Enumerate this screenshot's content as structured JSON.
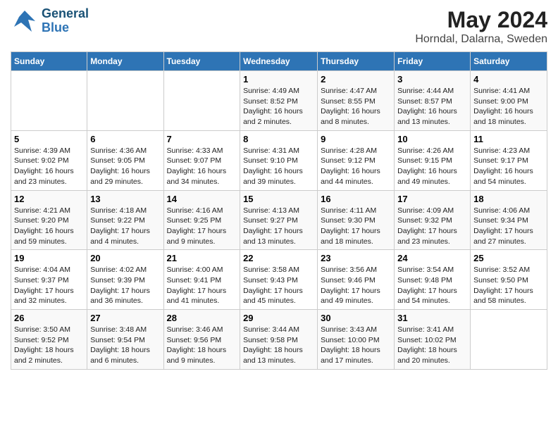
{
  "header": {
    "logo_line1": "General",
    "logo_line2": "Blue",
    "main_title": "May 2024",
    "subtitle": "Horndal, Dalarna, Sweden"
  },
  "calendar": {
    "days_of_week": [
      "Sunday",
      "Monday",
      "Tuesday",
      "Wednesday",
      "Thursday",
      "Friday",
      "Saturday"
    ],
    "weeks": [
      [
        {
          "day": "",
          "info": ""
        },
        {
          "day": "",
          "info": ""
        },
        {
          "day": "",
          "info": ""
        },
        {
          "day": "1",
          "info": "Sunrise: 4:49 AM\nSunset: 8:52 PM\nDaylight: 16 hours\nand 2 minutes."
        },
        {
          "day": "2",
          "info": "Sunrise: 4:47 AM\nSunset: 8:55 PM\nDaylight: 16 hours\nand 8 minutes."
        },
        {
          "day": "3",
          "info": "Sunrise: 4:44 AM\nSunset: 8:57 PM\nDaylight: 16 hours\nand 13 minutes."
        },
        {
          "day": "4",
          "info": "Sunrise: 4:41 AM\nSunset: 9:00 PM\nDaylight: 16 hours\nand 18 minutes."
        }
      ],
      [
        {
          "day": "5",
          "info": "Sunrise: 4:39 AM\nSunset: 9:02 PM\nDaylight: 16 hours\nand 23 minutes."
        },
        {
          "day": "6",
          "info": "Sunrise: 4:36 AM\nSunset: 9:05 PM\nDaylight: 16 hours\nand 29 minutes."
        },
        {
          "day": "7",
          "info": "Sunrise: 4:33 AM\nSunset: 9:07 PM\nDaylight: 16 hours\nand 34 minutes."
        },
        {
          "day": "8",
          "info": "Sunrise: 4:31 AM\nSunset: 9:10 PM\nDaylight: 16 hours\nand 39 minutes."
        },
        {
          "day": "9",
          "info": "Sunrise: 4:28 AM\nSunset: 9:12 PM\nDaylight: 16 hours\nand 44 minutes."
        },
        {
          "day": "10",
          "info": "Sunrise: 4:26 AM\nSunset: 9:15 PM\nDaylight: 16 hours\nand 49 minutes."
        },
        {
          "day": "11",
          "info": "Sunrise: 4:23 AM\nSunset: 9:17 PM\nDaylight: 16 hours\nand 54 minutes."
        }
      ],
      [
        {
          "day": "12",
          "info": "Sunrise: 4:21 AM\nSunset: 9:20 PM\nDaylight: 16 hours\nand 59 minutes."
        },
        {
          "day": "13",
          "info": "Sunrise: 4:18 AM\nSunset: 9:22 PM\nDaylight: 17 hours\nand 4 minutes."
        },
        {
          "day": "14",
          "info": "Sunrise: 4:16 AM\nSunset: 9:25 PM\nDaylight: 17 hours\nand 9 minutes."
        },
        {
          "day": "15",
          "info": "Sunrise: 4:13 AM\nSunset: 9:27 PM\nDaylight: 17 hours\nand 13 minutes."
        },
        {
          "day": "16",
          "info": "Sunrise: 4:11 AM\nSunset: 9:30 PM\nDaylight: 17 hours\nand 18 minutes."
        },
        {
          "day": "17",
          "info": "Sunrise: 4:09 AM\nSunset: 9:32 PM\nDaylight: 17 hours\nand 23 minutes."
        },
        {
          "day": "18",
          "info": "Sunrise: 4:06 AM\nSunset: 9:34 PM\nDaylight: 17 hours\nand 27 minutes."
        }
      ],
      [
        {
          "day": "19",
          "info": "Sunrise: 4:04 AM\nSunset: 9:37 PM\nDaylight: 17 hours\nand 32 minutes."
        },
        {
          "day": "20",
          "info": "Sunrise: 4:02 AM\nSunset: 9:39 PM\nDaylight: 17 hours\nand 36 minutes."
        },
        {
          "day": "21",
          "info": "Sunrise: 4:00 AM\nSunset: 9:41 PM\nDaylight: 17 hours\nand 41 minutes."
        },
        {
          "day": "22",
          "info": "Sunrise: 3:58 AM\nSunset: 9:43 PM\nDaylight: 17 hours\nand 45 minutes."
        },
        {
          "day": "23",
          "info": "Sunrise: 3:56 AM\nSunset: 9:46 PM\nDaylight: 17 hours\nand 49 minutes."
        },
        {
          "day": "24",
          "info": "Sunrise: 3:54 AM\nSunset: 9:48 PM\nDaylight: 17 hours\nand 54 minutes."
        },
        {
          "day": "25",
          "info": "Sunrise: 3:52 AM\nSunset: 9:50 PM\nDaylight: 17 hours\nand 58 minutes."
        }
      ],
      [
        {
          "day": "26",
          "info": "Sunrise: 3:50 AM\nSunset: 9:52 PM\nDaylight: 18 hours\nand 2 minutes."
        },
        {
          "day": "27",
          "info": "Sunrise: 3:48 AM\nSunset: 9:54 PM\nDaylight: 18 hours\nand 6 minutes."
        },
        {
          "day": "28",
          "info": "Sunrise: 3:46 AM\nSunset: 9:56 PM\nDaylight: 18 hours\nand 9 minutes."
        },
        {
          "day": "29",
          "info": "Sunrise: 3:44 AM\nSunset: 9:58 PM\nDaylight: 18 hours\nand 13 minutes."
        },
        {
          "day": "30",
          "info": "Sunrise: 3:43 AM\nSunset: 10:00 PM\nDaylight: 18 hours\nand 17 minutes."
        },
        {
          "day": "31",
          "info": "Sunrise: 3:41 AM\nSunset: 10:02 PM\nDaylight: 18 hours\nand 20 minutes."
        },
        {
          "day": "",
          "info": ""
        }
      ]
    ]
  }
}
